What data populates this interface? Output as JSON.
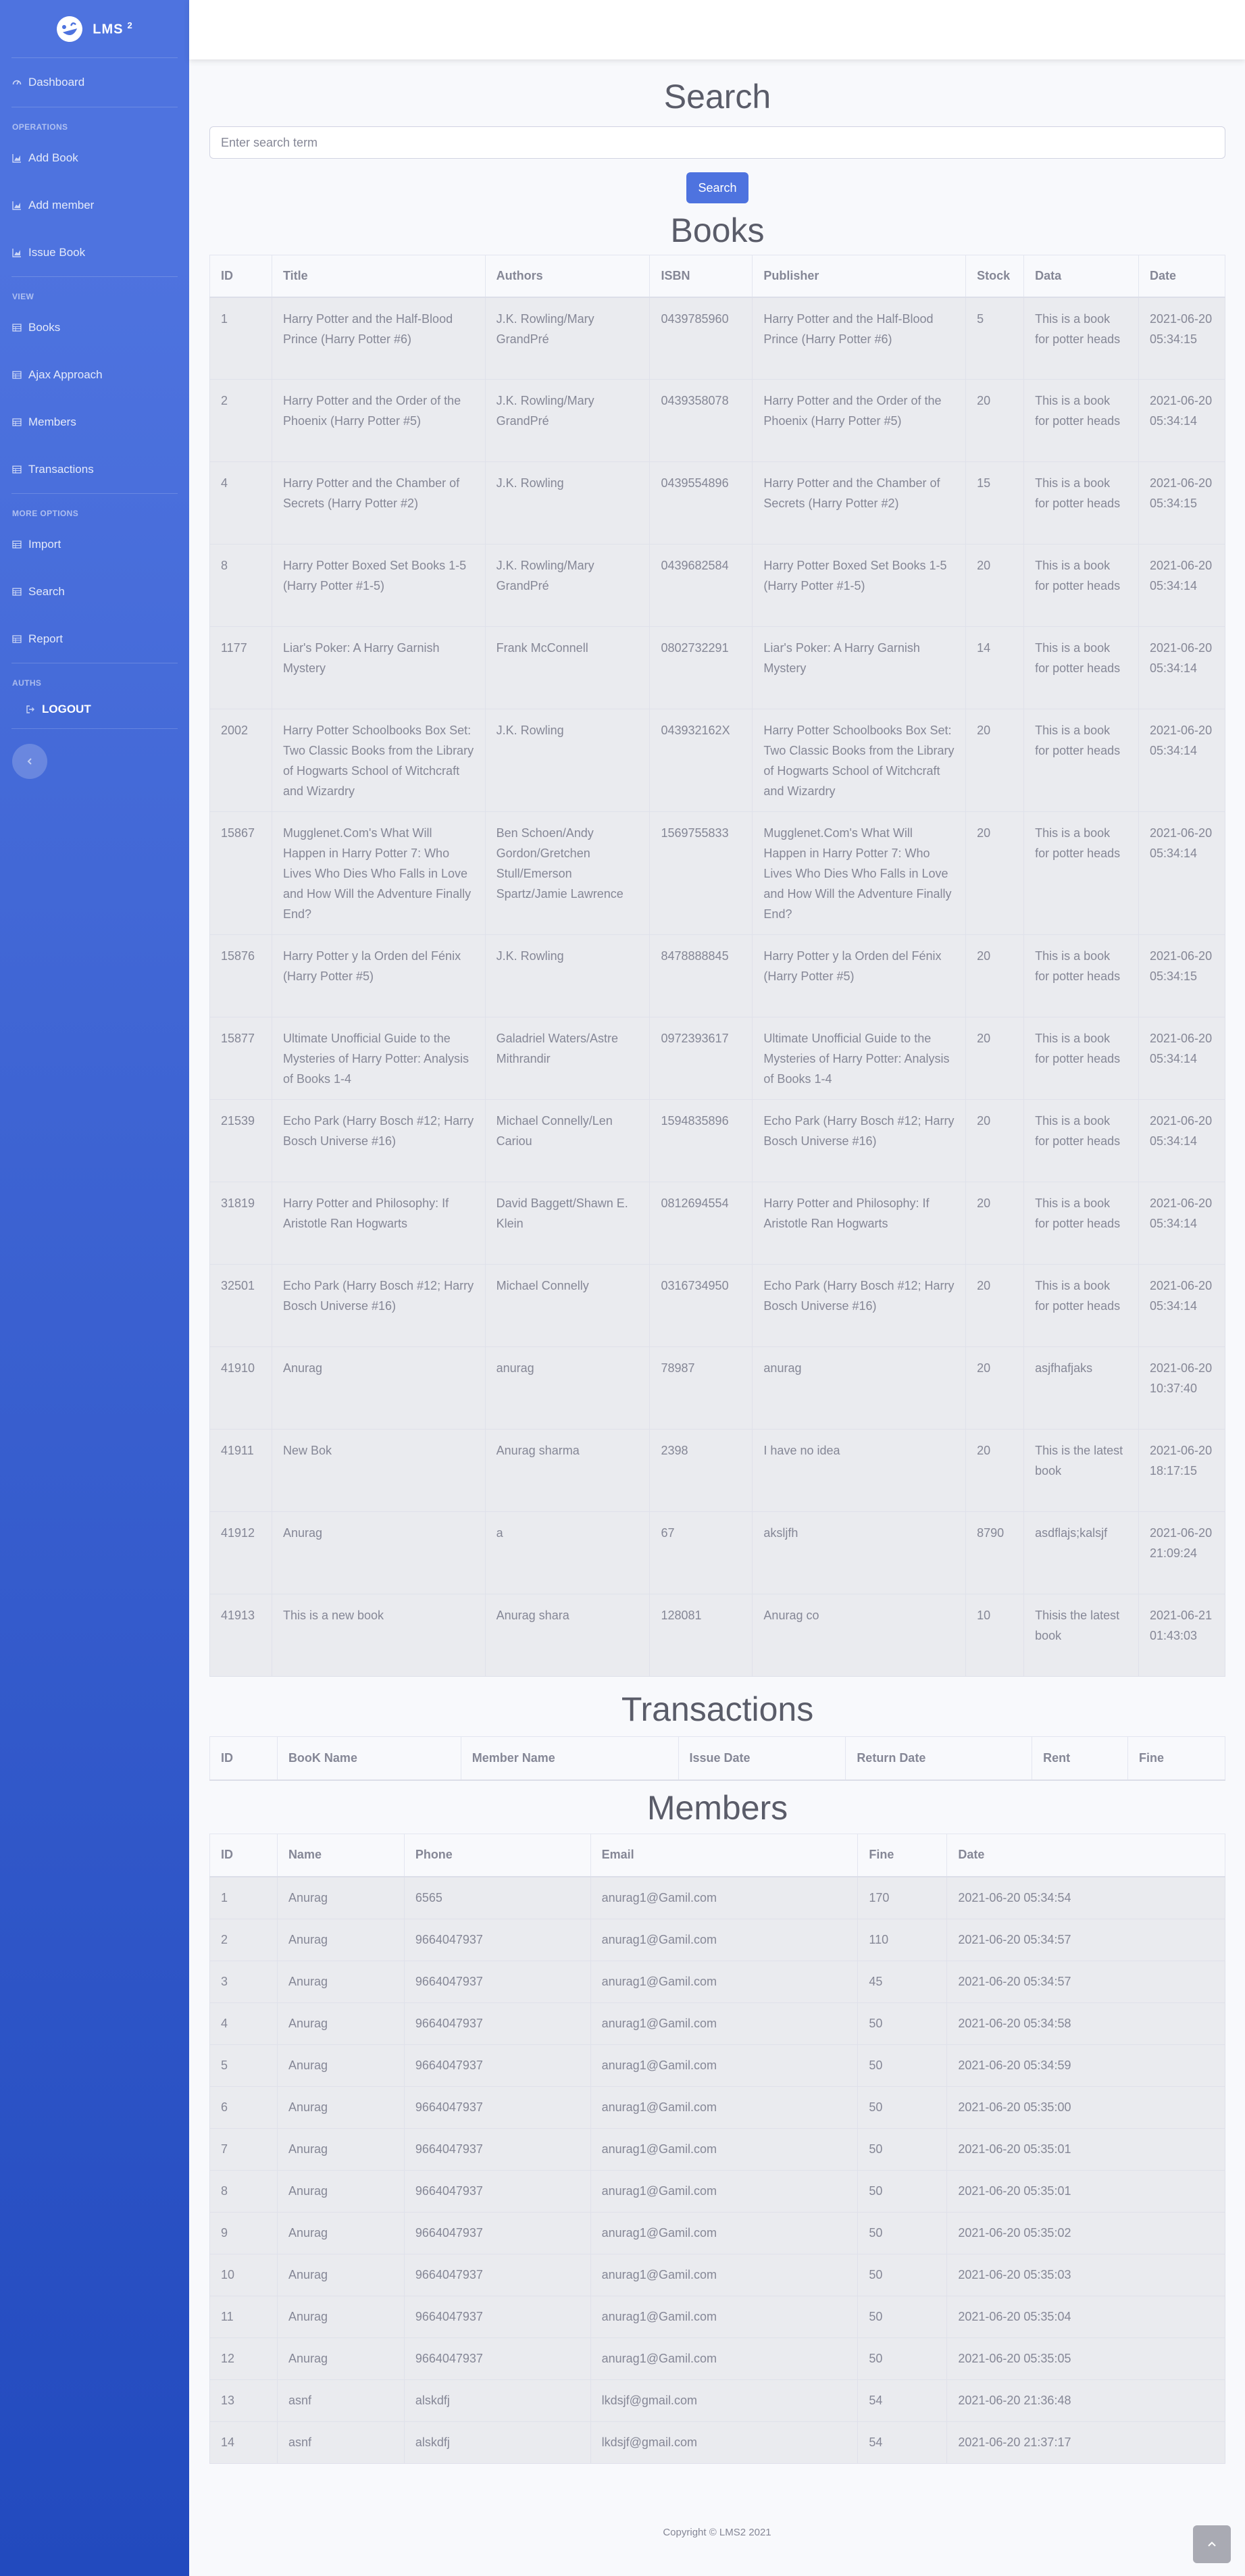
{
  "brand": {
    "name": "LMS",
    "sup": "2"
  },
  "sidebar": {
    "dashboard": "Dashboard",
    "headings": {
      "operations": "OPERATIONS",
      "view": "VIEW",
      "more": "MORE OPTIONS",
      "auths": "AUTHS"
    },
    "operations": [
      "Add Book",
      "Add member",
      "Issue Book"
    ],
    "view": [
      "Books",
      "Ajax Approach",
      "Members",
      "Transactions"
    ],
    "more": [
      "Import",
      "Search",
      "Report"
    ],
    "logout": "LOGOUT"
  },
  "search": {
    "title": "Search",
    "placeholder": "Enter search term",
    "button": "Search"
  },
  "books": {
    "title": "Books",
    "columns": [
      "ID",
      "Title",
      "Authors",
      "ISBN",
      "Publisher",
      "Stock",
      "Data",
      "Date"
    ],
    "rows": [
      [
        "1",
        "Harry Potter and the Half-Blood Prince (Harry Potter #6)",
        "J.K. Rowling/Mary GrandPré",
        "0439785960",
        "Harry Potter and the Half-Blood Prince (Harry Potter #6)",
        "5",
        "This is a book for potter heads",
        "2021-06-20 05:34:15"
      ],
      [
        "2",
        "Harry Potter and the Order of the Phoenix (Harry Potter #5)",
        "J.K. Rowling/Mary GrandPré",
        "0439358078",
        "Harry Potter and the Order of the Phoenix (Harry Potter #5)",
        "20",
        "This is a book for potter heads",
        "2021-06-20 05:34:14"
      ],
      [
        "4",
        "Harry Potter and the Chamber of Secrets (Harry Potter #2)",
        "J.K. Rowling",
        "0439554896",
        "Harry Potter and the Chamber of Secrets (Harry Potter #2)",
        "15",
        "This is a book for potter heads",
        "2021-06-20 05:34:15"
      ],
      [
        "8",
        "Harry Potter Boxed Set Books 1-5 (Harry Potter #1-5)",
        "J.K. Rowling/Mary GrandPré",
        "0439682584",
        "Harry Potter Boxed Set Books 1-5 (Harry Potter #1-5)",
        "20",
        "This is a book for potter heads",
        "2021-06-20 05:34:14"
      ],
      [
        "1177",
        "Liar's Poker: A Harry Garnish Mystery",
        "Frank McConnell",
        "0802732291",
        "Liar's Poker: A Harry Garnish Mystery",
        "14",
        "This is a book for potter heads",
        "2021-06-20 05:34:14"
      ],
      [
        "2002",
        "Harry Potter Schoolbooks Box Set: Two Classic Books from the Library of Hogwarts School of Witchcraft and Wizardry",
        "J.K. Rowling",
        "043932162X",
        "Harry Potter Schoolbooks Box Set: Two Classic Books from the Library of Hogwarts School of Witchcraft and Wizardry",
        "20",
        "This is a book for potter heads",
        "2021-06-20 05:34:14"
      ],
      [
        "15867",
        "Mugglenet.Com's What Will Happen in Harry Potter 7: Who Lives Who Dies Who Falls in Love and How Will the Adventure Finally End?",
        "Ben Schoen/Andy Gordon/Gretchen Stull/Emerson Spartz/Jamie Lawrence",
        "1569755833",
        "Mugglenet.Com's What Will Happen in Harry Potter 7: Who Lives Who Dies Who Falls in Love and How Will the Adventure Finally End?",
        "20",
        "This is a book for potter heads",
        "2021-06-20 05:34:14"
      ],
      [
        "15876",
        "Harry Potter y la Orden del Fénix (Harry Potter #5)",
        "J.K. Rowling",
        "8478888845",
        "Harry Potter y la Orden del Fénix (Harry Potter #5)",
        "20",
        "This is a book for potter heads",
        "2021-06-20 05:34:15"
      ],
      [
        "15877",
        "Ultimate Unofficial Guide to the Mysteries of Harry Potter: Analysis of Books 1-4",
        "Galadriel Waters/Astre Mithrandir",
        "0972393617",
        "Ultimate Unofficial Guide to the Mysteries of Harry Potter: Analysis of Books 1-4",
        "20",
        "This is a book for potter heads",
        "2021-06-20 05:34:14"
      ],
      [
        "21539",
        "Echo Park (Harry Bosch #12; Harry Bosch Universe #16)",
        "Michael Connelly/Len Cariou",
        "1594835896",
        "Echo Park (Harry Bosch #12; Harry Bosch Universe #16)",
        "20",
        "This is a book for potter heads",
        "2021-06-20 05:34:14"
      ],
      [
        "31819",
        "Harry Potter and Philosophy: If Aristotle Ran Hogwarts",
        "David Baggett/Shawn E. Klein",
        "0812694554",
        "Harry Potter and Philosophy: If Aristotle Ran Hogwarts",
        "20",
        "This is a book for potter heads",
        "2021-06-20 05:34:14"
      ],
      [
        "32501",
        "Echo Park (Harry Bosch #12; Harry Bosch Universe #16)",
        "Michael Connelly",
        "0316734950",
        "Echo Park (Harry Bosch #12; Harry Bosch Universe #16)",
        "20",
        "This is a book for potter heads",
        "2021-06-20 05:34:14"
      ],
      [
        "41910",
        "Anurag",
        "anurag",
        "78987",
        "anurag",
        "20",
        "asjfhafjaks",
        "2021-06-20 10:37:40"
      ],
      [
        "41911",
        "New Bok",
        "Anurag sharma",
        "2398",
        "I have no idea",
        "20",
        "This is the latest book",
        "2021-06-20 18:17:15"
      ],
      [
        "41912",
        "Anurag",
        "a",
        "67",
        "aksljfh",
        "8790",
        "asdflajs;kalsjf",
        "2021-06-20 21:09:24"
      ],
      [
        "41913",
        "This is a new book",
        "Anurag shara",
        "128081",
        "Anurag co",
        "10",
        "Thisis the latest book",
        "2021-06-21 01:43:03"
      ]
    ]
  },
  "transactions": {
    "title": "Transactions",
    "columns": [
      "ID",
      "BooK Name",
      "Member Name",
      "Issue Date",
      "Return Date",
      "Rent",
      "Fine"
    ]
  },
  "members": {
    "title": "Members",
    "columns": [
      "ID",
      "Name",
      "Phone",
      "Email",
      "Fine",
      "Date"
    ],
    "rows": [
      [
        "1",
        "Anurag",
        "6565",
        "anurag1@Gamil.com",
        "170",
        "2021-06-20 05:34:54"
      ],
      [
        "2",
        "Anurag",
        "9664047937",
        "anurag1@Gamil.com",
        "110",
        "2021-06-20 05:34:57"
      ],
      [
        "3",
        "Anurag",
        "9664047937",
        "anurag1@Gamil.com",
        "45",
        "2021-06-20 05:34:57"
      ],
      [
        "4",
        "Anurag",
        "9664047937",
        "anurag1@Gamil.com",
        "50",
        "2021-06-20 05:34:58"
      ],
      [
        "5",
        "Anurag",
        "9664047937",
        "anurag1@Gamil.com",
        "50",
        "2021-06-20 05:34:59"
      ],
      [
        "6",
        "Anurag",
        "9664047937",
        "anurag1@Gamil.com",
        "50",
        "2021-06-20 05:35:00"
      ],
      [
        "7",
        "Anurag",
        "9664047937",
        "anurag1@Gamil.com",
        "50",
        "2021-06-20 05:35:01"
      ],
      [
        "8",
        "Anurag",
        "9664047937",
        "anurag1@Gamil.com",
        "50",
        "2021-06-20 05:35:01"
      ],
      [
        "9",
        "Anurag",
        "9664047937",
        "anurag1@Gamil.com",
        "50",
        "2021-06-20 05:35:02"
      ],
      [
        "10",
        "Anurag",
        "9664047937",
        "anurag1@Gamil.com",
        "50",
        "2021-06-20 05:35:03"
      ],
      [
        "11",
        "Anurag",
        "9664047937",
        "anurag1@Gamil.com",
        "50",
        "2021-06-20 05:35:04"
      ],
      [
        "12",
        "Anurag",
        "9664047937",
        "anurag1@Gamil.com",
        "50",
        "2021-06-20 05:35:05"
      ],
      [
        "13",
        "asnf",
        "alskdfj",
        "lkdsjf@gmail.com",
        "54",
        "2021-06-20 21:36:48"
      ],
      [
        "14",
        "asnf",
        "alskdfj",
        "lkdsjf@gmail.com",
        "54",
        "2021-06-20 21:37:17"
      ]
    ]
  },
  "footer": "Copyright © LMS2 2021",
  "icons": {
    "brand": "laugh-wink-icon",
    "dashboard": "tachometer-icon",
    "operations": "chart-area-icon",
    "view": "table-icon",
    "logout": "sign-out-icon",
    "toggler": "chevron-left-icon",
    "scroll_top": "chevron-up-icon"
  }
}
